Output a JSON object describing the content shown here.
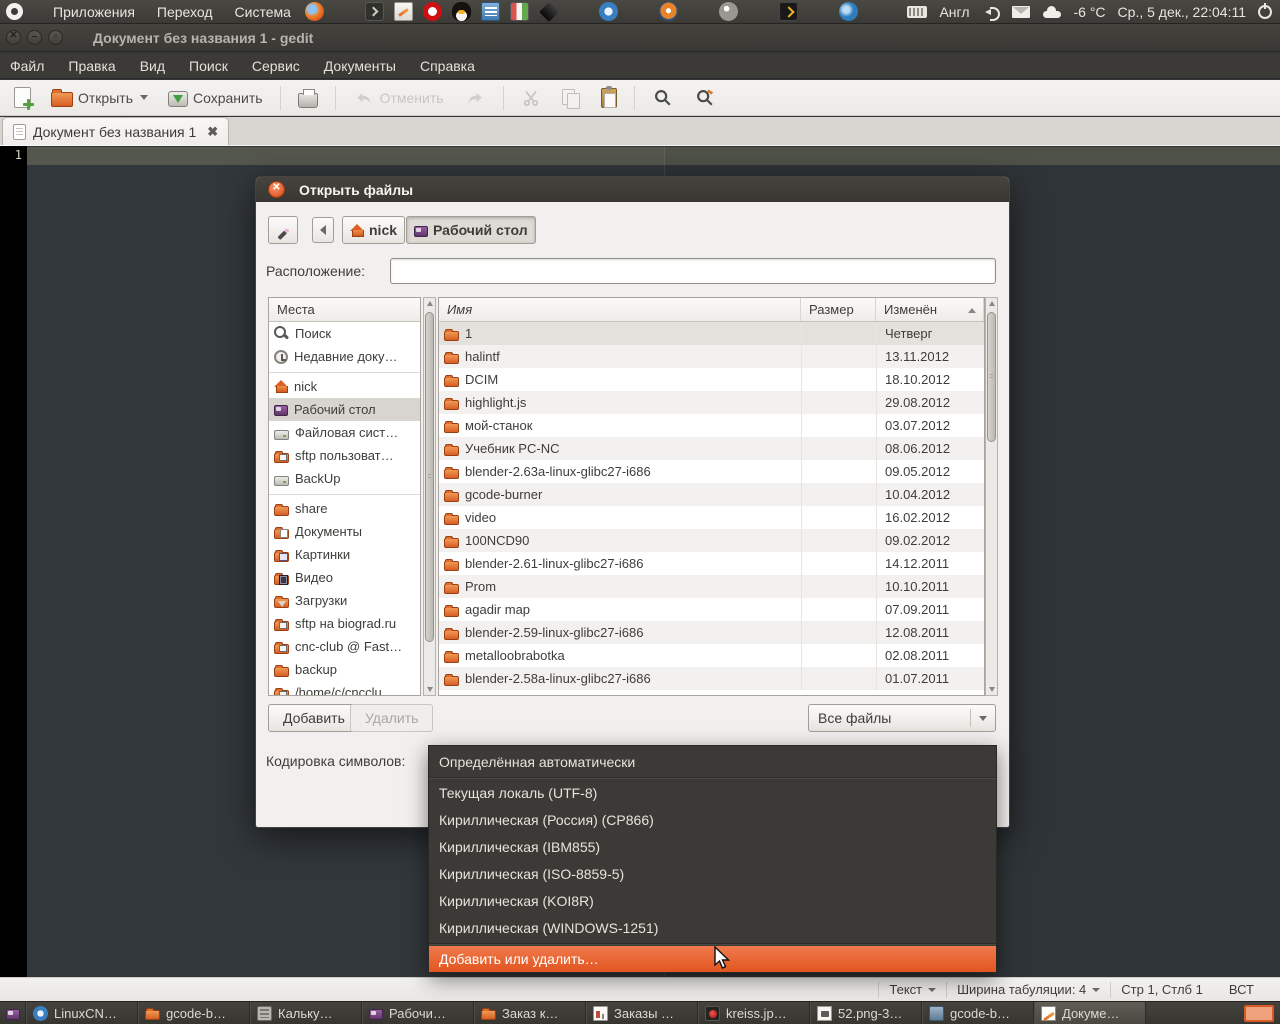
{
  "colors": {
    "panel": "#3c3a36",
    "accent_orange": "#e95420",
    "menu_highlight": "#e05620",
    "editor_bg": "#32373b",
    "dialog_bg": "#f2f0ee"
  },
  "top_panel": {
    "menus": [
      "Приложения",
      "Переход",
      "Система"
    ],
    "app_icons": [
      {
        "icon": "firefox"
      },
      {
        "separator": true
      },
      {
        "icon": "terminal"
      },
      {
        "icon": "gedit-app"
      },
      {
        "icon": "opera"
      },
      {
        "icon": "tux"
      },
      {
        "icon": "writer"
      },
      {
        "icon": "files"
      },
      {
        "icon": "inkscape"
      },
      {
        "separator": true
      },
      {
        "icon": "chromium"
      },
      {
        "separator": true
      },
      {
        "icon": "blender"
      },
      {
        "separator": true
      },
      {
        "icon": "gimp"
      },
      {
        "separator": true
      },
      {
        "icon": "terminal2"
      },
      {
        "separator": true
      },
      {
        "icon": "thunderbird"
      }
    ],
    "language": "Англ",
    "temperature": "-6 °C",
    "clock": "Ср., 5 дек., 22:04:11"
  },
  "gedit": {
    "title": "Документ без названия 1 - gedit",
    "menu_items": [
      "Файл",
      "Правка",
      "Вид",
      "Поиск",
      "Сервис",
      "Документы",
      "Справка"
    ],
    "toolbar": {
      "open": "Открыть",
      "save": "Сохранить",
      "undo": "Отменить"
    },
    "tab": {
      "label": "Документ без названия 1"
    },
    "editor": {
      "line_number": "1"
    },
    "statusbar": {
      "mode": "Текст",
      "tab_width": "Ширина табуляции: 4",
      "position": "Стр 1, Стлб 1",
      "overwrite": "ВСТ"
    }
  },
  "dialog": {
    "title": "Открыть файлы",
    "path_buttons": [
      {
        "label": "nick",
        "icon": "home"
      },
      {
        "label": "Рабочий стол",
        "icon": "desktop",
        "active": true
      }
    ],
    "location_label": "Расположение:",
    "location_value": "",
    "places": {
      "header": "Места",
      "items": [
        {
          "label": "Поиск",
          "icon": "search"
        },
        {
          "label": "Недавние доку…",
          "icon": "clock"
        },
        {
          "separator": true
        },
        {
          "label": "nick",
          "icon": "home"
        },
        {
          "label": "Рабочий стол",
          "icon": "desktop",
          "selected": true
        },
        {
          "label": "Файловая сист…",
          "icon": "drive"
        },
        {
          "label": "sftp пользоват…",
          "icon": "remote"
        },
        {
          "label": "BackUp",
          "icon": "drive"
        },
        {
          "separator": true
        },
        {
          "label": "share",
          "icon": "folder"
        },
        {
          "label": "Документы",
          "icon": "folder-doc"
        },
        {
          "label": "Картинки",
          "icon": "folder-img"
        },
        {
          "label": "Видео",
          "icon": "folder-video"
        },
        {
          "label": "Загрузки",
          "icon": "folder-down"
        },
        {
          "label": "sftp на biograd.ru",
          "icon": "remote"
        },
        {
          "label": "cnc-club @ Fast…",
          "icon": "remote"
        },
        {
          "label": "backup",
          "icon": "folder"
        },
        {
          "label": "/home/c/cncclu…",
          "icon": "remote"
        }
      ]
    },
    "table": {
      "columns": [
        "Имя",
        "Размер",
        "Изменён"
      ],
      "rows": [
        {
          "name": "1",
          "size": "",
          "modified": "Четверг",
          "icon": "folder",
          "selected": true
        },
        {
          "name": "halintf",
          "size": "",
          "modified": "13.11.2012",
          "icon": "folder"
        },
        {
          "name": "DCIM",
          "size": "",
          "modified": "18.10.2012",
          "icon": "folder"
        },
        {
          "name": "highlight.js",
          "size": "",
          "modified": "29.08.2012",
          "icon": "folder"
        },
        {
          "name": "мой-станок",
          "size": "",
          "modified": "03.07.2012",
          "icon": "folder"
        },
        {
          "name": "Учебник PC-NC",
          "size": "",
          "modified": "08.06.2012",
          "icon": "folder"
        },
        {
          "name": "blender-2.63a-linux-glibc27-i686",
          "size": "",
          "modified": "09.05.2012",
          "icon": "folder"
        },
        {
          "name": "gcode-burner",
          "size": "",
          "modified": "10.04.2012",
          "icon": "folder"
        },
        {
          "name": "video",
          "size": "",
          "modified": "16.02.2012",
          "icon": "folder"
        },
        {
          "name": "100NCD90",
          "size": "",
          "modified": "09.02.2012",
          "icon": "folder"
        },
        {
          "name": "blender-2.61-linux-glibc27-i686",
          "size": "",
          "modified": "14.12.2011",
          "icon": "folder"
        },
        {
          "name": "Prom",
          "size": "",
          "modified": "10.10.2011",
          "icon": "folder"
        },
        {
          "name": "agadir map",
          "size": "",
          "modified": "07.09.2011",
          "icon": "folder"
        },
        {
          "name": "blender-2.59-linux-glibc27-i686",
          "size": "",
          "modified": "12.08.2011",
          "icon": "folder"
        },
        {
          "name": "metalloobrabotka",
          "size": "",
          "modified": "02.08.2011",
          "icon": "folder"
        },
        {
          "name": "blender-2.58a-linux-glibc27-i686",
          "size": "",
          "modified": "01.07.2011",
          "icon": "folder"
        }
      ]
    },
    "add_button": "Добавить",
    "remove_button": "Удалить",
    "filter_value": "Все файлы",
    "encoding_label": "Кодировка символов:"
  },
  "encoding_menu": {
    "items": [
      {
        "label": "Определённая автоматически"
      },
      {
        "separator": true
      },
      {
        "label": "Текущая локаль (UTF-8)"
      },
      {
        "label": "Кириллическая (Россия) (CP866)"
      },
      {
        "label": "Кириллическая (IBM855)"
      },
      {
        "label": "Кириллическая (ISO-8859-5)"
      },
      {
        "label": "Кириллическая (KOI8R)"
      },
      {
        "label": "Кириллическая (WINDOWS-1251)"
      },
      {
        "separator": true
      },
      {
        "label": "Добавить или удалить…",
        "highlight": true
      }
    ]
  },
  "taskbar": {
    "items": [
      {
        "icon": "chromium",
        "label": "LinuxCN…"
      },
      {
        "icon": "folder",
        "label": "gcode-b…"
      },
      {
        "icon": "calculator",
        "label": "Кальку…"
      },
      {
        "icon": "desktop",
        "label": "Рабочи…"
      },
      {
        "icon": "folder",
        "label": "Заказ к…"
      },
      {
        "icon": "doc-chart",
        "label": "Заказы …"
      },
      {
        "icon": "image-red",
        "label": "kreiss.jp…"
      },
      {
        "icon": "image-page",
        "label": "52.png-3…"
      },
      {
        "icon": "archive",
        "label": "gcode-b…"
      },
      {
        "icon": "gedit",
        "label": "Докуме…",
        "active": true
      }
    ]
  }
}
